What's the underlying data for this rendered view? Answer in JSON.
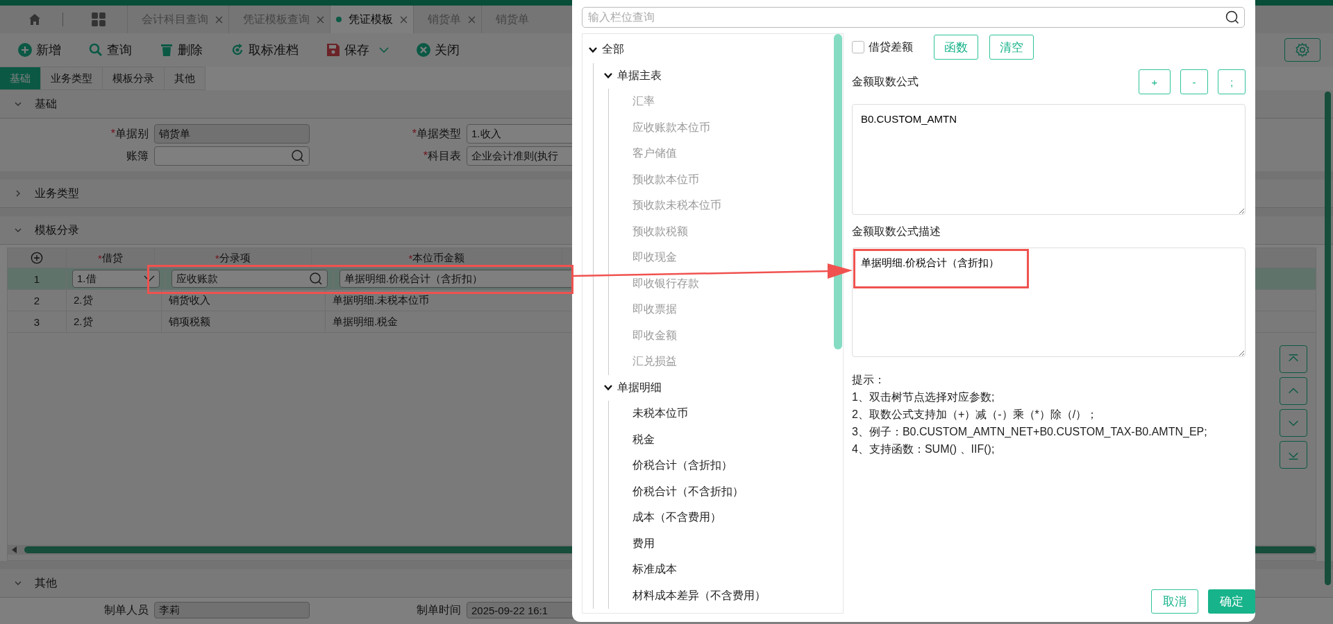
{
  "tabs": [
    {
      "label": "会计科目查询",
      "selected": false,
      "closable": true
    },
    {
      "label": "凭证模板查询",
      "selected": false,
      "closable": true
    },
    {
      "label": "凭证模板",
      "selected": true,
      "closable": true
    },
    {
      "label": "销货单",
      "selected": false,
      "closable": true
    },
    {
      "label": "销货单",
      "selected": false,
      "closable": false
    }
  ],
  "toolbar": [
    {
      "label": "新增",
      "kind": "add"
    },
    {
      "label": "查询",
      "kind": "search"
    },
    {
      "label": "删除",
      "kind": "delete"
    },
    {
      "label": "取标准档",
      "kind": "standard"
    },
    {
      "label": "保存",
      "kind": "save"
    },
    {
      "label": "关闭",
      "kind": "close"
    }
  ],
  "form_tabs": [
    {
      "label": "基础",
      "selected": true
    },
    {
      "label": "业务类型",
      "selected": false
    },
    {
      "label": "模板分录",
      "selected": false
    },
    {
      "label": "其他",
      "selected": false
    }
  ],
  "basic": {
    "title": "基础",
    "expanded": true,
    "fields": [
      {
        "label": "单据别",
        "required_mark": "*",
        "value": "销货单",
        "kind": "readonly"
      },
      {
        "label": "单据类型",
        "required_mark": "*",
        "value": "1.收入",
        "kind": "text"
      },
      {
        "label": "账簿",
        "kind": "search"
      },
      {
        "label": "科目表",
        "required_mark": "*",
        "value": "企业会计准则(执行",
        "kind": "text"
      }
    ]
  },
  "business_type": {
    "title": "业务类型",
    "expanded": false
  },
  "template_entries": {
    "title": "模板分录",
    "expanded": true,
    "columns": [
      {
        "label": "借贷",
        "required_mark": "*"
      },
      {
        "label": "分录项",
        "required_mark": "*"
      },
      {
        "label": "本位币金额",
        "required_mark": "*"
      }
    ],
    "rows": [
      {
        "index": "1",
        "selected": true,
        "debit_credit": "1.借",
        "entry_item": "应收账款",
        "amount": "单据明细.价税合计（含折扣）"
      },
      {
        "index": "2",
        "selected": false,
        "debit_credit": "2.贷",
        "entry_item": "销货收入",
        "amount": "单据明细.未税本位币"
      },
      {
        "index": "3",
        "selected": false,
        "debit_credit": "2.贷",
        "entry_item": "销项税额",
        "amount": "单据明细.税金"
      }
    ]
  },
  "other": {
    "title": "其他",
    "expanded": true,
    "fields": [
      {
        "label": "制单人员",
        "value": "李莉"
      },
      {
        "label": "制单时间",
        "value": "2025-09-22 16:1"
      }
    ]
  },
  "dialog": {
    "search": {
      "placeholder": "输入栏位查询"
    },
    "tree": [
      {
        "label": "全部",
        "expanded": true,
        "disabled": false,
        "children": [
          {
            "label": "单据主表",
            "expanded": true,
            "disabled": false,
            "children": [
              {
                "label": "汇率",
                "disabled": true
              },
              {
                "label": "应收账款本位币",
                "disabled": true
              },
              {
                "label": "客户储值",
                "disabled": true
              },
              {
                "label": "预收款本位币",
                "disabled": true
              },
              {
                "label": "预收款未税本位币",
                "disabled": true
              },
              {
                "label": "预收款税额",
                "disabled": true
              },
              {
                "label": "即收现金",
                "disabled": true
              },
              {
                "label": "即收银行存款",
                "disabled": true
              },
              {
                "label": "即收票据",
                "disabled": true
              },
              {
                "label": "即收金额",
                "disabled": true
              },
              {
                "label": "汇兑损益",
                "disabled": true
              }
            ]
          },
          {
            "label": "单据明细",
            "expanded": true,
            "disabled": false,
            "children": [
              {
                "label": "未税本位币",
                "disabled": false
              },
              {
                "label": "税金",
                "disabled": false
              },
              {
                "label": "价税合计（含折扣）",
                "disabled": false
              },
              {
                "label": "价税合计（不含折扣）",
                "disabled": false
              },
              {
                "label": "成本（不含费用）",
                "disabled": false
              },
              {
                "label": "费用",
                "disabled": false
              },
              {
                "label": "标准成本",
                "disabled": false
              },
              {
                "label": "材料成本差异（不含费用）",
                "disabled": false
              }
            ]
          }
        ]
      }
    ],
    "balance_checkbox": {
      "label": "借贷差额",
      "checked": false
    },
    "tool_buttons": [
      "函数",
      "清空"
    ],
    "formula": {
      "label": "金额取数公式",
      "operators": [
        "+",
        "-",
        ";"
      ],
      "value": "B0.CUSTOM_AMTN"
    },
    "description": {
      "label": "金额取数公式描述",
      "value": "单据明细.价税合计（含折扣）"
    },
    "hints": {
      "title": "提示：",
      "lines": [
        "1、双击树节点选择对应参数;",
        "2、取数公式支持加（+）减（-）乘（*）除（/）；",
        "3、例子：B0.CUSTOM_AMTN_NET+B0.CUSTOM_TAX-B0.AMTN_EP;",
        "4、支持函数：SUM() 、IIF();"
      ]
    },
    "footer_buttons": [
      {
        "label": "取消",
        "kind": "secondary"
      },
      {
        "label": "确定",
        "kind": "primary"
      }
    ]
  }
}
